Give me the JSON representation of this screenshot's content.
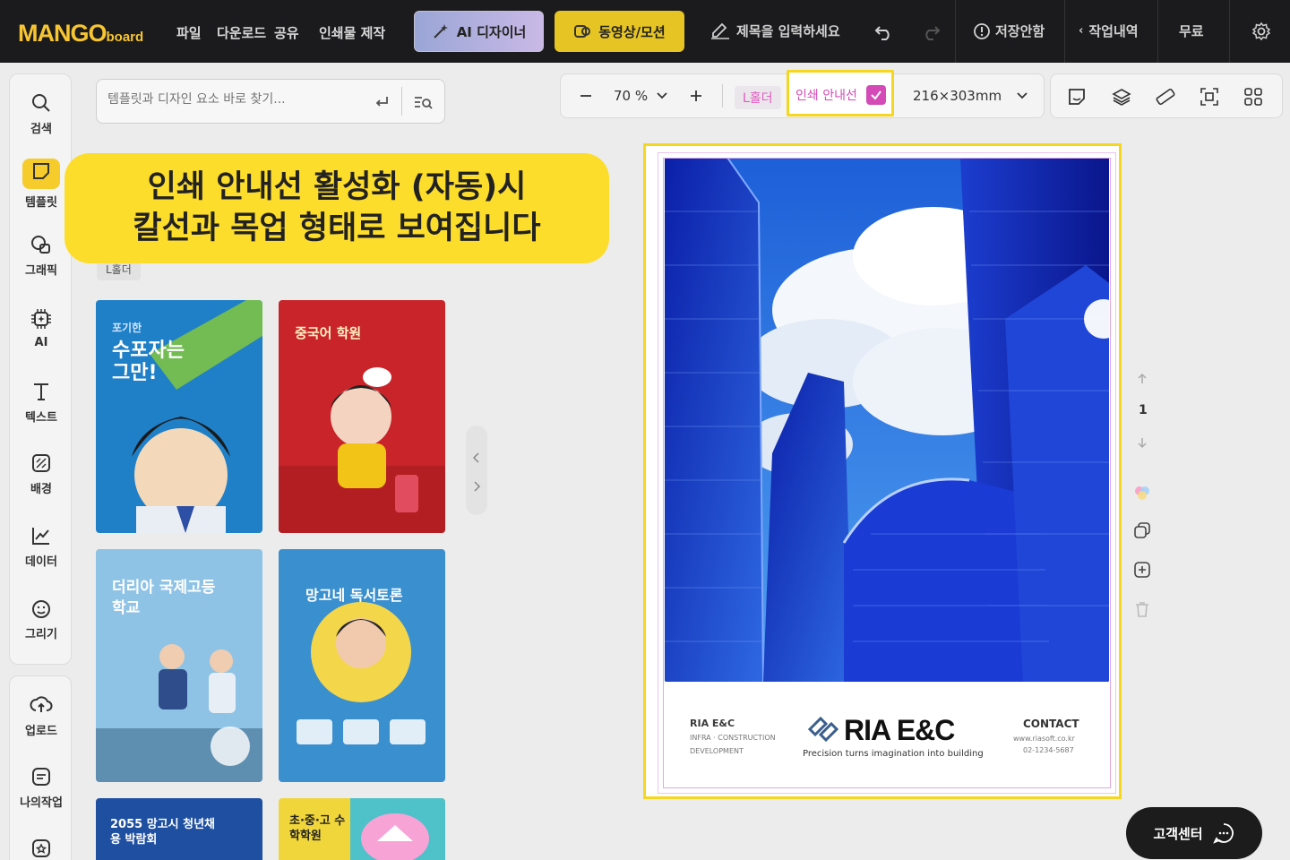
{
  "app": {
    "logo_main": "MANGO",
    "logo_sub": "board"
  },
  "menu": {
    "file": "파일",
    "download": "다운로드",
    "share": "공유",
    "print": "인쇄물 제작"
  },
  "toolbar": {
    "ai_designer": "AI 디자이너",
    "video": "동영상/모션",
    "title_placeholder": "제목을 입력하세요",
    "save_status": "저장안함",
    "history": "작업내역",
    "plan": "무료"
  },
  "sidebar": {
    "items": [
      {
        "label": "검색",
        "icon": "search-icon"
      },
      {
        "label": "템플릿",
        "icon": "template-icon"
      },
      {
        "label": "그래픽",
        "icon": "graphic-icon"
      },
      {
        "label": "AI",
        "icon": "ai-icon"
      },
      {
        "label": "텍스트",
        "icon": "text-icon"
      },
      {
        "label": "배경",
        "icon": "background-icon"
      },
      {
        "label": "데이터",
        "icon": "chart-icon"
      },
      {
        "label": "그리기",
        "icon": "draw-icon"
      }
    ],
    "bottom_items": [
      {
        "label": "업로드",
        "icon": "upload-icon"
      },
      {
        "label": "나의작업",
        "icon": "mywork-icon"
      }
    ]
  },
  "panel": {
    "search_placeholder": "템플릿과 디자인 요소 바로 찾기...",
    "section_tag": "L홀더"
  },
  "templates": [
    {
      "title": "수포자는 그만!",
      "tag": "포기한",
      "bg": "#1f7fc7"
    },
    {
      "title": "중국어 학원",
      "tag": "",
      "bg": "#c9242a"
    },
    {
      "title": "더리아 국제고등학교",
      "tag": "",
      "bg": "#7bb7e0"
    },
    {
      "title": "망고네 독서토론",
      "tag": "",
      "bg": "#3a8fcf"
    },
    {
      "title": "2055 망고시 청년채용 박람회",
      "tag": "",
      "bg": "#1e4fa1"
    },
    {
      "title": "초·중·고 수학학원",
      "tag": "",
      "bg": "#f0d63a"
    }
  ],
  "callout": {
    "line1": "인쇄 안내선 활성화 (자동)시",
    "line2": "칼선과 목업 형태로 보여집니다"
  },
  "canvas_toolbar": {
    "zoom": "70 %",
    "lholder": "L홀더",
    "print_guide": "인쇄 안내선",
    "print_guide_checked": true,
    "size": "216×303mm"
  },
  "poster": {
    "brand_small": "RIA E&C",
    "brand_sub1": "INFRA · CONSTRUCTION",
    "brand_sub2": "DEVELOPMENT",
    "brand_big": "RIA E&C",
    "tagline": "Precision turns imagination into building",
    "contact_title": "CONTACT",
    "contact_web": "www.riasoft.co.kr",
    "contact_phone": "02-1234-5687"
  },
  "page_nav": {
    "page": "1"
  },
  "support": {
    "label": "고객센터"
  },
  "colors": {
    "accent": "#f5cc2b",
    "guide": "#d44bb7",
    "topbar": "#1b1b1d"
  }
}
